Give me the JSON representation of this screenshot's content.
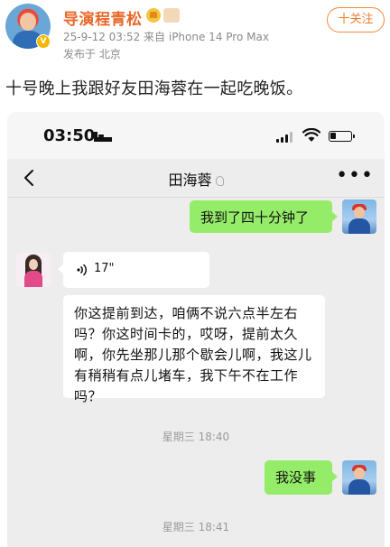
{
  "post": {
    "author_name": "导演程青松",
    "meta": "25-9-12 03:52  来自 iPhone 14 Pro Max",
    "location": "发布于 北京",
    "follow_label": "十关注",
    "text": "十号晚上我跟好友田海蓉在一起吃晚饭。",
    "badges": [
      "crown-badge-icon",
      "vip-level-icon"
    ],
    "accent_color": "#e8682a"
  },
  "phone": {
    "status_time": "03:50",
    "status_icons": [
      "sleep-mode-icon",
      "signal-icon",
      "wifi-icon",
      "battery-icon"
    ]
  },
  "chat": {
    "title": "田海蓉",
    "messages": [
      {
        "from": "me",
        "type": "text",
        "text": "我到了四十分钟了"
      },
      {
        "from": "other",
        "type": "voice",
        "duration": "17\""
      },
      {
        "from": "other",
        "type": "text",
        "text": "你这提前到达，咱俩不说六点半左右吗？你这时间卡的，哎呀，提前太久啊，你先坐那儿那个歇会儿啊，我这儿有稍稍有点儿堵车，我下午不在工作吗？"
      },
      {
        "type": "timestamp",
        "text": "星期三 18:40"
      },
      {
        "from": "me",
        "type": "text",
        "text": "我没事"
      },
      {
        "type": "timestamp",
        "text": "星期三 18:41"
      }
    ],
    "bubble_color_me": "#95ec69",
    "bubble_color_other": "#ffffff",
    "background_color": "#ededed"
  }
}
